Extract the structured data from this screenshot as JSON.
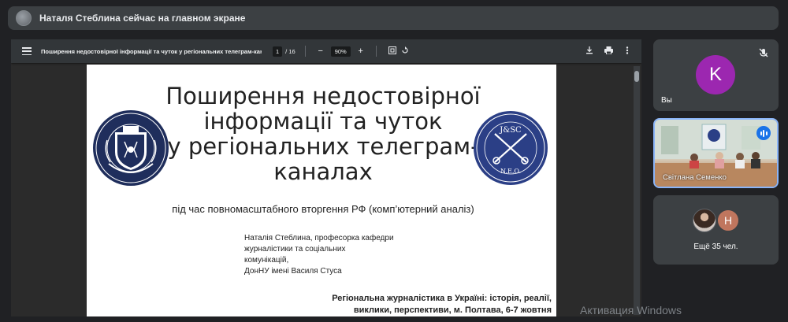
{
  "presenter_bar": {
    "text": "Наталя Стеблина сейчас на главном экране"
  },
  "pdf_viewer": {
    "title": "Поширення недостовірної інформації та чуток у регіональних телеграм-каналах",
    "current_page": "1",
    "total_pages": "/ 16",
    "zoom": "90%"
  },
  "slide": {
    "title_lines": [
      "Поширення недостовірної",
      "інформації та чуток",
      "у регіональних телеграм-",
      "каналах"
    ],
    "subtitle": "під час повномасштабного вторгення РФ (комп’ютерний аналіз)",
    "author_lines": [
      "Наталія Стеблина, професорка кафедри",
      "журналістики та соціальних",
      "комунікацій,",
      "ДонНУ імені Василя Стуса"
    ],
    "conference_lines": [
      "Регіональна журналістика в Україні: історія, реалії,",
      "виклики, перспективи, м. Полтава, 6-7 жовтня"
    ],
    "logo_right_text": [
      "J&SC",
      "N.E.O."
    ]
  },
  "watermark": "Активация Windows",
  "participants": {
    "self": {
      "initial": "K",
      "label": "Вы",
      "color": "#9c27b0"
    },
    "speaker": {
      "label": "Світлана Семенко"
    },
    "others": {
      "initial": "Н",
      "label": "Ещё 35 чел."
    }
  },
  "colors": {
    "background": "#202124",
    "tile": "#3c4043",
    "active_border": "#8ab4f8",
    "pdf_toolbar": "#323639"
  }
}
